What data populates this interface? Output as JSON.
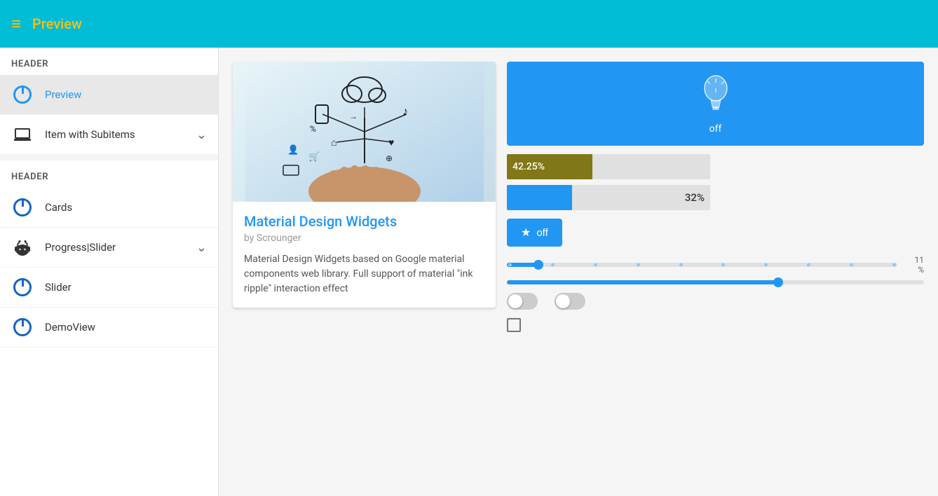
{
  "topbar": {
    "title": "Preview",
    "menu_icon": "≡"
  },
  "sidebar": {
    "header1": "Header",
    "header2": "Header",
    "items": [
      {
        "id": "preview",
        "label": "Preview",
        "icon": "power",
        "active": true,
        "hasChevron": false
      },
      {
        "id": "item-with-subitems",
        "label": "Item with Subitems",
        "icon": "laptop",
        "active": false,
        "hasChevron": true
      },
      {
        "id": "cards",
        "label": "Cards",
        "icon": "power",
        "active": false,
        "hasChevron": false
      },
      {
        "id": "progress-slider",
        "label": "Progress|Slider",
        "icon": "android",
        "active": false,
        "hasChevron": true
      },
      {
        "id": "slider",
        "label": "Slider",
        "icon": "power",
        "active": false,
        "hasChevron": false
      },
      {
        "id": "demoview",
        "label": "DemoView",
        "icon": "power",
        "active": false,
        "hasChevron": false
      }
    ]
  },
  "card": {
    "title": "Material Design Widgets",
    "subtitle": "by Scrounger",
    "text": "Material Design Widgets based on Google material components web library. Full support of material \"ink ripple\" interaction effect"
  },
  "light_widget": {
    "label": "off"
  },
  "star_button": {
    "label": "off"
  },
  "progress_bars": [
    {
      "label": "42.25%",
      "percent": 42
    },
    {
      "label": "32%",
      "percent": 32
    }
  ],
  "sliders": [
    {
      "value": "11",
      "unit": "%",
      "fill_percent": 8
    },
    {
      "value": "",
      "unit": "",
      "fill_percent": 65
    }
  ],
  "app_title": "Material Design Widgets",
  "app_subtitle": "by Scrounger"
}
